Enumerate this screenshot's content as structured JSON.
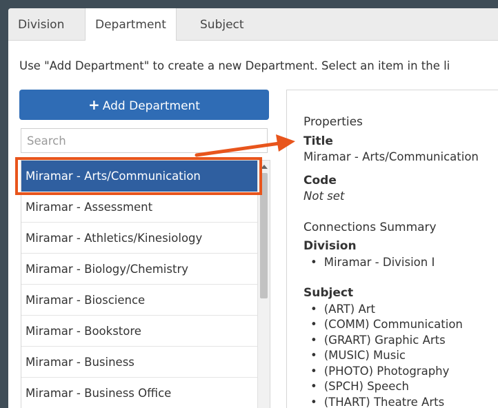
{
  "tabs": [
    {
      "label": "Division",
      "active": false
    },
    {
      "label": "Department",
      "active": true
    },
    {
      "label": "Subject",
      "active": false
    }
  ],
  "instructions": "Use \"Add Department\" to create a new Department. Select an item in the li",
  "add_button": {
    "icon": "plus-icon",
    "label": "Add Department"
  },
  "search": {
    "placeholder": "Search",
    "value": ""
  },
  "list": {
    "items": [
      "Miramar - Arts/Communication",
      "Miramar - Assessment",
      "Miramar - Athletics/Kinesiology",
      "Miramar - Biology/Chemistry",
      "Miramar - Bioscience",
      "Miramar - Bookstore",
      "Miramar - Business",
      "Miramar - Business Office"
    ],
    "selected_index": 0
  },
  "details": {
    "properties_heading": "Properties",
    "title_label": "Title",
    "title_value": "Miramar - Arts/Communication",
    "code_label": "Code",
    "code_value": "Not set",
    "connections_heading": "Connections Summary",
    "division_label": "Division",
    "division_items": [
      "Miramar - Division I"
    ],
    "subject_label": "Subject",
    "subject_items": [
      "(ART) Art",
      "(COMM) Communication",
      "(GRART) Graphic Arts",
      "(MUSIC) Music",
      "(PHOTO) Photography",
      "(SPCH) Speech",
      "(THART) Theatre Arts"
    ]
  },
  "colors": {
    "accent_blue": "#2f6cb5",
    "selected_blue": "#2f5fa0",
    "annotation_orange": "#e8551c"
  }
}
